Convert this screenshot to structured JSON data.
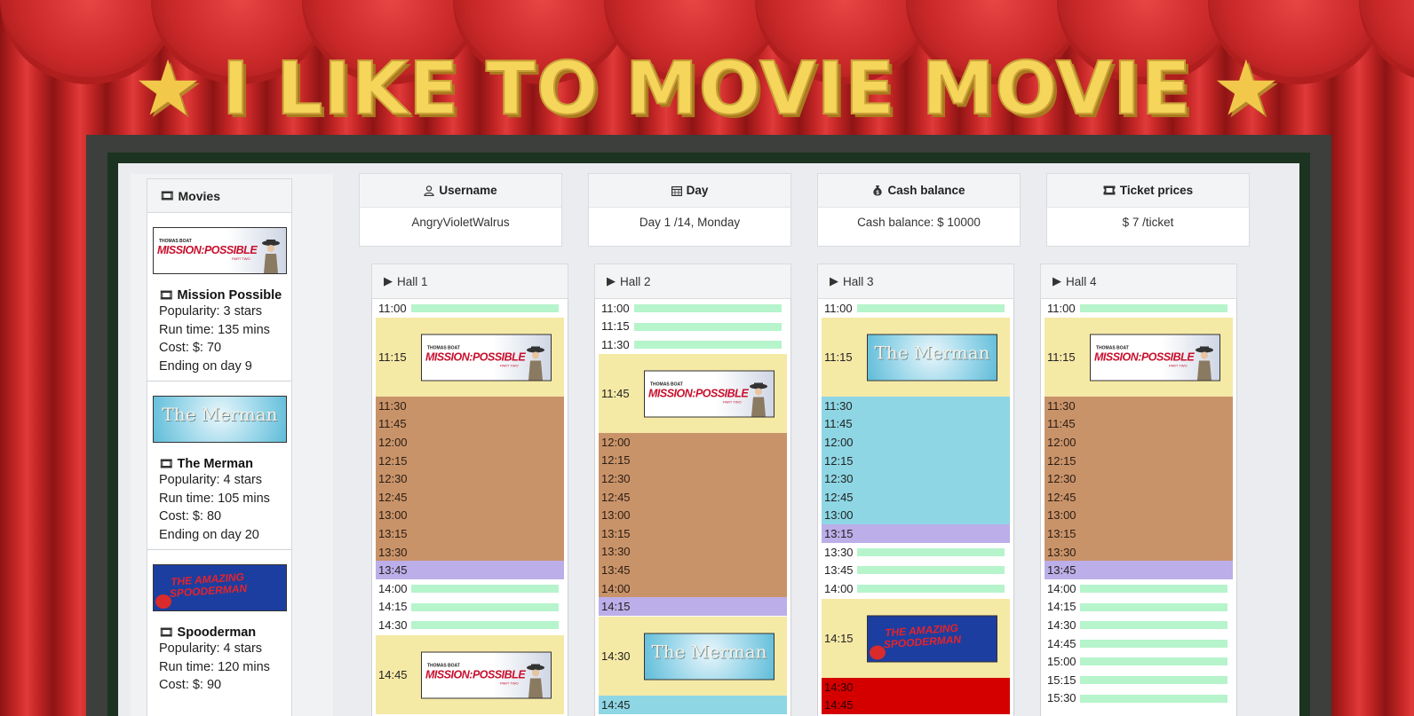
{
  "banner": {
    "title": "I LIKE TO MOVIE MOVIE"
  },
  "sidebar": {
    "header": "Movies",
    "movies": [
      {
        "name": "Mission Possible",
        "popularity": "Popularity: 3 stars",
        "runtime": "Run time: 135 mins",
        "cost": "Cost: $: 70",
        "ending": "Ending on day 9",
        "poster": "mission-possible"
      },
      {
        "name": "The Merman",
        "popularity": "Popularity: 4 stars",
        "runtime": "Run time: 105 mins",
        "cost": "Cost: $: 80",
        "ending": "Ending on day 20",
        "poster": "the-merman"
      },
      {
        "name": "Spooderman",
        "popularity": "Popularity: 4 stars",
        "runtime": "Run time: 120 mins",
        "cost": "Cost: $: 90",
        "ending": "",
        "poster": "spooderman"
      }
    ]
  },
  "posters": {
    "mp_top": "THOMAS BOAT",
    "mp_main": "MISSION:POSSIBLE",
    "mp_sub": "PART TWO",
    "merman": "The Merman",
    "spooderman_line1": "THE AMAZING",
    "spooderman_line2": "SPOODERMAN"
  },
  "info": {
    "username": {
      "label": "Username",
      "value": "AngryVioletWalrus",
      "icon": "user-icon"
    },
    "day": {
      "label": "Day",
      "value": "Day 1 /14, Monday",
      "icon": "calendar-icon"
    },
    "cash": {
      "label": "Cash balance",
      "value": "Cash balance: $ 10000",
      "icon": "money-bag-icon"
    },
    "prices": {
      "label": "Ticket prices",
      "value": "$ 7 /ticket",
      "icon": "ticket-icon"
    }
  },
  "halls": [
    {
      "name": "Hall 1"
    },
    {
      "name": "Hall 2"
    },
    {
      "name": "Hall 3"
    },
    {
      "name": "Hall 4"
    }
  ],
  "colors": {
    "free_slot": "#b6f4cc",
    "showing": "#f5e9a6",
    "mission_possible_block": "#c9936a",
    "merman_block": "#8ed6e4",
    "cleanup": "#bcaee8",
    "conflict": "#d40000"
  },
  "schedule": {
    "hall1": {
      "t1100": "11:00",
      "show1": "11:15",
      "b1130": "11:30",
      "b1145": "11:45",
      "b1200": "12:00",
      "b1215": "12:15",
      "b1230": "12:30",
      "b1245": "12:45",
      "b1300": "13:00",
      "b1315": "13:15",
      "b1330": "13:30",
      "p1345": "13:45",
      "t1400": "14:00",
      "t1415": "14:15",
      "t1430": "14:30",
      "show2": "14:45"
    },
    "hall2": {
      "t1100": "11:00",
      "t1115": "11:15",
      "t1130": "11:30",
      "show1": "11:45",
      "b1200": "12:00",
      "b1215": "12:15",
      "b1230": "12:30",
      "b1245": "12:45",
      "b1300": "13:00",
      "b1315": "13:15",
      "b1330": "13:30",
      "b1345": "13:45",
      "b1400": "14:00",
      "p1415": "14:15",
      "show2": "14:30",
      "t1445": "14:45"
    },
    "hall3": {
      "t1100": "11:00",
      "show1": "11:15",
      "b1130": "11:30",
      "b1145": "11:45",
      "b1200": "12:00",
      "b1215": "12:15",
      "b1230": "12:30",
      "b1245": "12:45",
      "b1300": "13:00",
      "p1315": "13:15",
      "t1330": "13:30",
      "t1345": "13:45",
      "t1400": "14:00",
      "show2": "14:15",
      "r1430": "14:30",
      "r1445": "14:45"
    },
    "hall4": {
      "t1100": "11:00",
      "show1": "11:15",
      "b1130": "11:30",
      "b1145": "11:45",
      "b1200": "12:00",
      "b1215": "12:15",
      "b1230": "12:30",
      "b1245": "12:45",
      "b1300": "13:00",
      "b1315": "13:15",
      "b1330": "13:30",
      "p1345": "13:45",
      "t1400": "14:00",
      "t1415": "14:15",
      "t1430": "14:30",
      "t1445": "14:45",
      "t1500": "15:00",
      "t1515": "15:15",
      "t1530": "15:30"
    }
  }
}
